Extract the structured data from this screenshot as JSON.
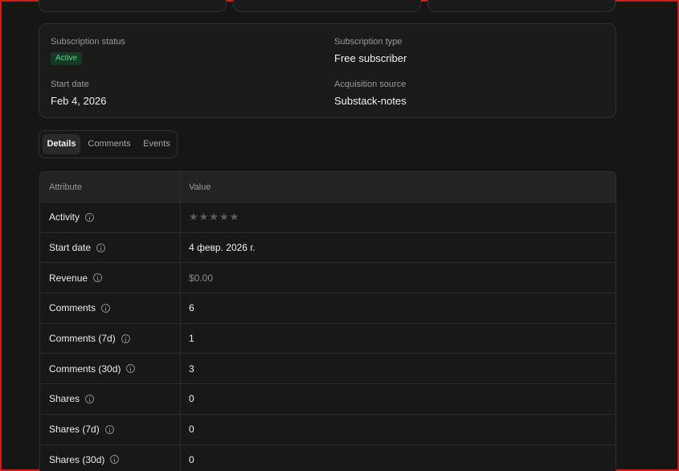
{
  "summary": {
    "subscription_status": {
      "label": "Subscription status",
      "value": "Active"
    },
    "subscription_type": {
      "label": "Subscription type",
      "value": "Free subscriber"
    },
    "start_date": {
      "label": "Start date",
      "value": "Feb 4, 2026"
    },
    "acquisition_source": {
      "label": "Acquisition source",
      "value": "Substack-notes"
    }
  },
  "tabs": [
    {
      "label": "Details",
      "active": true
    },
    {
      "label": "Comments",
      "active": false
    },
    {
      "label": "Events",
      "active": false
    }
  ],
  "table": {
    "headers": {
      "attribute": "Attribute",
      "value": "Value"
    },
    "rows": [
      {
        "attribute": "Activity",
        "value": "★★★★★",
        "kind": "stars"
      },
      {
        "attribute": "Start date",
        "value": "4 февр. 2026 г."
      },
      {
        "attribute": "Revenue",
        "value": "$0.00",
        "kind": "muted"
      },
      {
        "attribute": "Comments",
        "value": "6"
      },
      {
        "attribute": "Comments (7d)",
        "value": "1"
      },
      {
        "attribute": "Comments (30d)",
        "value": "3"
      },
      {
        "attribute": "Shares",
        "value": "0"
      },
      {
        "attribute": "Shares (7d)",
        "value": "0"
      },
      {
        "attribute": "Shares (30d)",
        "value": "0"
      }
    ]
  },
  "colors": {
    "background": "#161616",
    "badge_bg": "#143a26",
    "badge_text": "#4fd487",
    "border": "#303030"
  },
  "icons": {
    "info": "info-circle-icon"
  }
}
